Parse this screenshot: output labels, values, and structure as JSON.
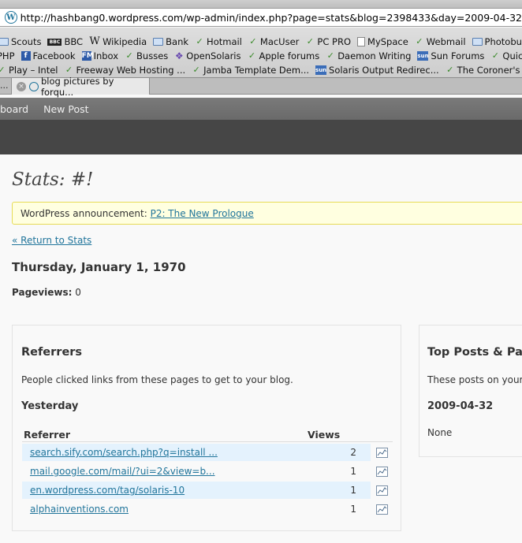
{
  "browser": {
    "url": "http://hashbang0.wordpress.com/wp-admin/index.php?page=stats&blog=2398433&day=2009-04-32",
    "bookmarks_row1": [
      {
        "label": "Scouts",
        "icon": "folder-icon"
      },
      {
        "label": "BBC",
        "icon": "bbc-icon"
      },
      {
        "label": "Wikipedia",
        "icon": "wikipedia-icon"
      },
      {
        "label": "Bank",
        "icon": "folder-icon"
      },
      {
        "label": "Hotmail",
        "icon": "leaf-icon"
      },
      {
        "label": "MacUser",
        "icon": "leaf-icon"
      },
      {
        "label": "PC PRO",
        "icon": "leaf-icon"
      },
      {
        "label": "MySpace",
        "icon": "doc-icon"
      },
      {
        "label": "Webmail",
        "icon": "leaf-icon"
      },
      {
        "label": "Photobucket",
        "icon": "folder-icon"
      }
    ],
    "bookmarks_row2": [
      {
        "label": "PHP",
        "icon": "none"
      },
      {
        "label": "Facebook",
        "icon": "facebook-icon"
      },
      {
        "label": "Inbox",
        "icon": "fm-icon"
      },
      {
        "label": "Busses",
        "icon": "leaf-icon"
      },
      {
        "label": "OpenSolaris",
        "icon": "diamond-icon"
      },
      {
        "label": "Apple forums",
        "icon": "leaf-icon"
      },
      {
        "label": "Daemon Writing",
        "icon": "leaf-icon"
      },
      {
        "label": "Sun Forums",
        "icon": "sun-icon"
      },
      {
        "label": "Quicd",
        "icon": "leaf-icon"
      }
    ],
    "bookmarks_row3": [
      {
        "label": "Play – Intel",
        "icon": "leaf-icon"
      },
      {
        "label": "Freeway Web Hosting ...",
        "icon": "leaf-icon"
      },
      {
        "label": "Jamba Template Dem...",
        "icon": "leaf-icon"
      },
      {
        "label": "Solaris Output Redirec...",
        "icon": "sun-icon"
      },
      {
        "label": "The Coroner's Tool",
        "icon": "leaf-icon"
      }
    ],
    "tab_prev": "...",
    "tab_active_label": "blog pictures by forqu..."
  },
  "adminbar": {
    "dashboard_label": "board",
    "newpost_label": "New Post"
  },
  "page": {
    "title": "Stats: #!",
    "notice_prefix": "WordPress announcement: ",
    "notice_link": "P2: The New Prologue",
    "return_link": "« Return to Stats",
    "date_heading": "Thursday, January 1, 1970",
    "pageviews_label": "Pageviews:",
    "pageviews_value": "0"
  },
  "referrers": {
    "heading": "Referrers",
    "description": "People clicked links from these pages to get to your blog.",
    "period": "Yesterday",
    "col_referrer": "Referrer",
    "col_views": "Views",
    "rows": [
      {
        "referrer": "search.sify.com/search.php?q=install ...",
        "views": "2"
      },
      {
        "referrer": "mail.google.com/mail/?ui=2&view=b...",
        "views": "1"
      },
      {
        "referrer": "en.wordpress.com/tag/solaris-10",
        "views": "1"
      },
      {
        "referrer": "alphainventions.com",
        "views": "1"
      }
    ]
  },
  "top_posts": {
    "heading": "Top Posts & Pag",
    "description": "These posts on your",
    "date": "2009-04-32",
    "none_text": "None"
  }
}
